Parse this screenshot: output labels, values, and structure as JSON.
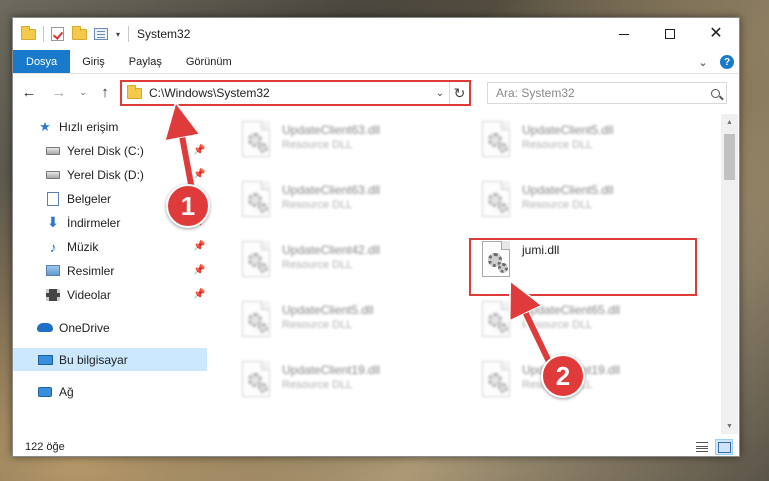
{
  "window": {
    "title": "System32"
  },
  "qat": {
    "dropdown_glyph": "▾"
  },
  "controls": {
    "minimize": "min-glyph",
    "maximize": "max-glyph",
    "close": "✕"
  },
  "ribbon": {
    "tabs": [
      {
        "label": "Dosya"
      },
      {
        "label": "Giriş"
      },
      {
        "label": "Paylaş"
      },
      {
        "label": "Görünüm"
      }
    ],
    "collapse_glyph": "⌄",
    "help_glyph": "?"
  },
  "nav": {
    "back": "←",
    "forward": "→",
    "recent": "⌄",
    "up": "↑"
  },
  "address": {
    "path": "C:\\Windows\\System32",
    "dropdown_glyph": "⌄",
    "refresh_glyph": "↻"
  },
  "search": {
    "placeholder": "Ara: System32"
  },
  "sidebar": {
    "pin_glyph": "📌",
    "items": [
      {
        "label": "Hızlı erişim",
        "icon": "star-icon"
      },
      {
        "label": "Yerel Disk (C:)",
        "icon": "drive-icon"
      },
      {
        "label": "Yerel Disk (D:)",
        "icon": "drive-icon"
      },
      {
        "label": "Belgeler",
        "icon": "document-icon"
      },
      {
        "label": "İndirmeler",
        "icon": "download-icon"
      },
      {
        "label": "Müzik",
        "icon": "music-icon"
      },
      {
        "label": "Resimler",
        "icon": "pictures-icon"
      },
      {
        "label": "Videolar",
        "icon": "videos-icon"
      },
      {
        "label": "OneDrive",
        "icon": "cloud-icon"
      },
      {
        "label": "Bu bilgisayar",
        "icon": "computer-icon"
      },
      {
        "label": "Ağ",
        "icon": "network-icon"
      }
    ]
  },
  "files": [
    {
      "name": "UpdateClient63.dll",
      "desc": "Resource DLL"
    },
    {
      "name": "UpdateClient5.dll",
      "desc": "Resource DLL"
    },
    {
      "name": "UpdateClient63.dll",
      "desc": "Resource DLL"
    },
    {
      "name": "UpdateClient5.dll",
      "desc": "Resource DLL"
    },
    {
      "name": "UpdateClient42.dll",
      "desc": "Resource DLL"
    },
    {
      "name": "jumi.dll",
      "desc": ""
    },
    {
      "name": "UpdateClient5.dll",
      "desc": "Resource DLL"
    },
    {
      "name": "UpdateClient65.dll",
      "desc": "Resource DLL"
    },
    {
      "name": "UpdateClient19.dll",
      "desc": "Resource DLL"
    },
    {
      "name": "UpdateClient19.dll",
      "desc": "Resource DLL"
    }
  ],
  "status": {
    "count": "122 öğe"
  },
  "annotations": {
    "step1": "1",
    "step2": "2",
    "color": "#e03b3b"
  }
}
